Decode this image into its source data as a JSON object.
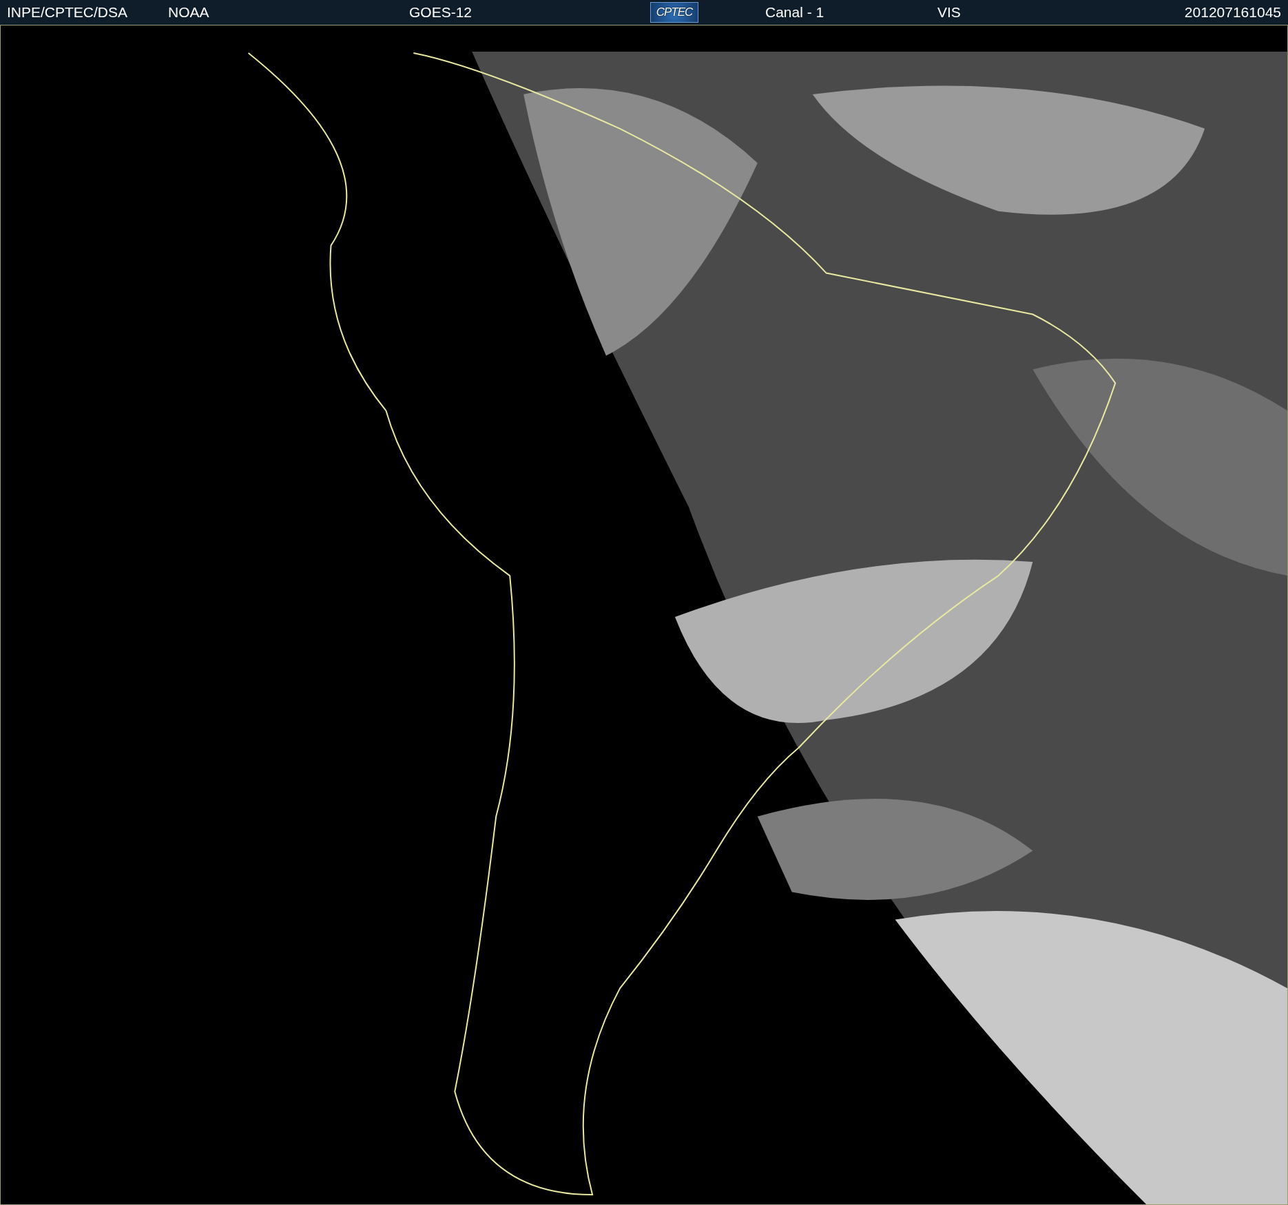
{
  "header": {
    "items": [
      {
        "kind": "text",
        "text": "INPE/CPTEC/DSA"
      },
      {
        "kind": "text",
        "text": "NOAA"
      },
      {
        "kind": "text",
        "text": "GOES-12"
      },
      {
        "kind": "logo",
        "text": "CPTEC"
      },
      {
        "kind": "text",
        "text": "Canal - 1"
      },
      {
        "kind": "text",
        "text": "VIS"
      },
      {
        "kind": "text",
        "text": "201207161045"
      }
    ]
  }
}
